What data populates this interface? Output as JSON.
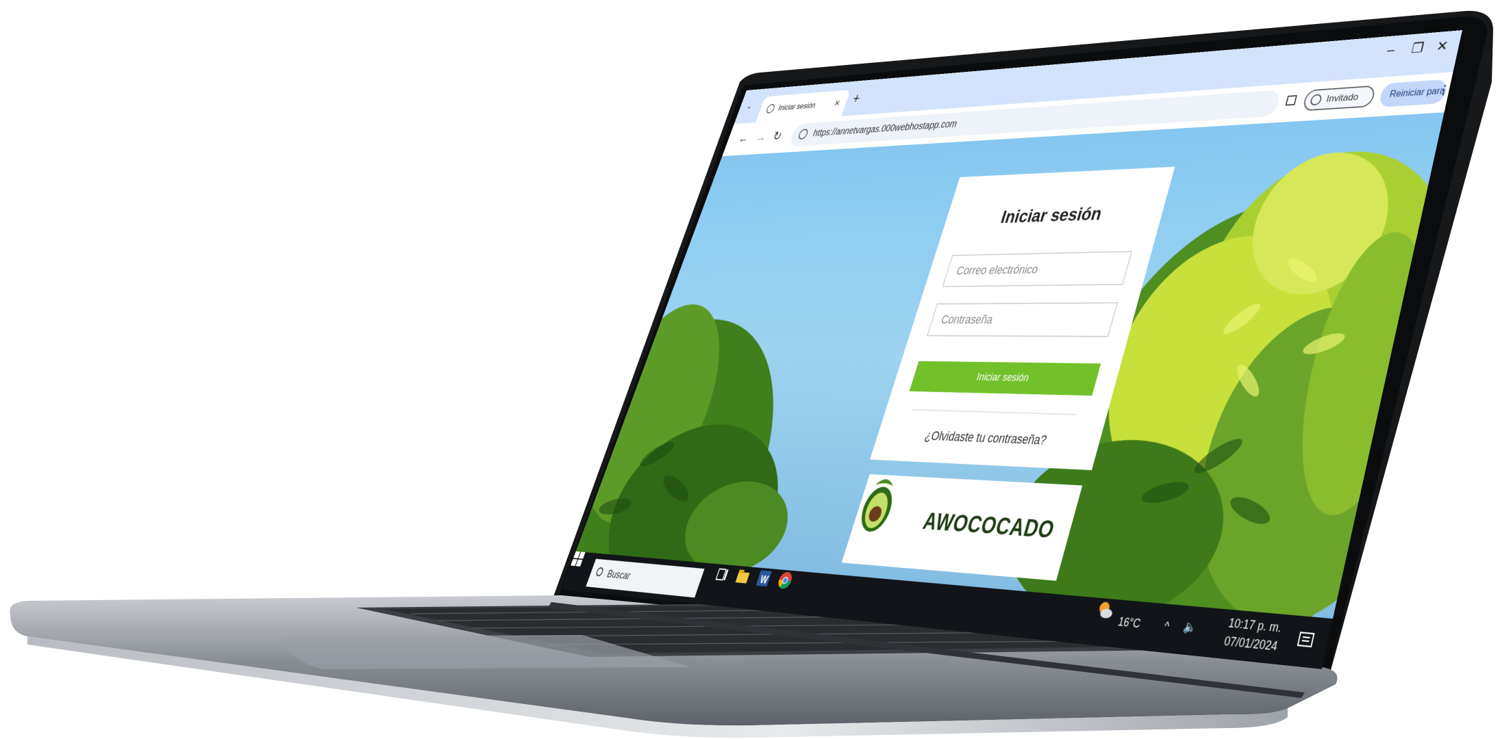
{
  "browser": {
    "tab_title": "Iniciar sesión",
    "tab_close": "×",
    "tab_list": "⌄",
    "new_tab": "+",
    "url": "https://annetvargas.000webhostapp.com",
    "profile_label": "Invitado",
    "update_label": "Reiniciar para actualizar",
    "menu_icon": "⋮",
    "minimize": "–",
    "maximize": "❐",
    "close": "✕",
    "back": "←",
    "forward": "→",
    "reload": "↻"
  },
  "login": {
    "title": "Iniciar sesión",
    "email_placeholder": "Correo electrónico",
    "password_placeholder": "Contraseña",
    "submit_label": "Iniciar sesión",
    "forgot_label": "¿Olvidaste tu contraseña?"
  },
  "brand": {
    "logo_text": "AWOCOCADO"
  },
  "taskbar": {
    "search_label": "Buscar",
    "weather_temp": "16°C",
    "time": "10:17 p. m.",
    "date": "07/01/2024",
    "tray_chevron": "^",
    "volume_icon": "🔈"
  },
  "colors": {
    "login_button": "#72c12a",
    "sky": "#8fcdf2",
    "foliage": "#4f8f22",
    "foliage_light": "#c7e03b",
    "taskbar": "#111418",
    "tabbar": "#d3e3fd"
  },
  "icons": {
    "start": "windows-start-icon",
    "task_view": "task-view-icon",
    "file_explorer": "folder-icon",
    "word": "word-icon",
    "chrome": "chrome-icon",
    "weather": "weather-icon",
    "notifications": "notification-icon"
  }
}
